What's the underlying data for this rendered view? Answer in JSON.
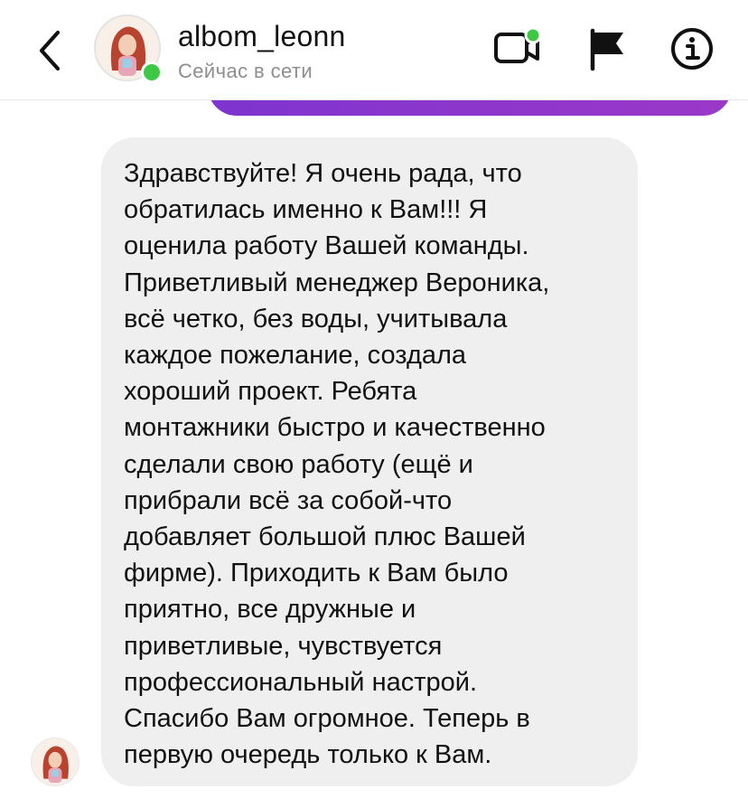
{
  "header": {
    "username": "albom_leonn",
    "status": "Сейчас в сети",
    "icons": {
      "back": "chevron-left-icon",
      "video": "video-call-icon",
      "flag": "flag-icon",
      "info": "info-icon"
    },
    "online_color": "#3ec845",
    "video_badge_color": "#3ec845"
  },
  "chat": {
    "previous_bubble_color": "#8b2fc6",
    "incoming_bubble_color": "#efefef",
    "message": {
      "text": "Здравствуйте! Я очень рада, что\nобратилась именно к Вам!!! Я\nоценила работу Вашей команды.\nПриветливый менеджер Вероника,\nвсё четко, без воды, учитывала\nкаждое пожелание, создала\nхороший проект. Ребята\nмонтажники быстро и качественно\nсделали свою работу (ещё и\nприбрали всё за собой-что\nдобавляет большой плюс Вашей\nфирме). Приходить к Вам было\nприятно, все дружные и\nприветливые, чувствуется\nпрофессиональный настрой.\nСпасибо Вам огромное. Теперь в\nпервую очередь только к Вам."
    }
  }
}
